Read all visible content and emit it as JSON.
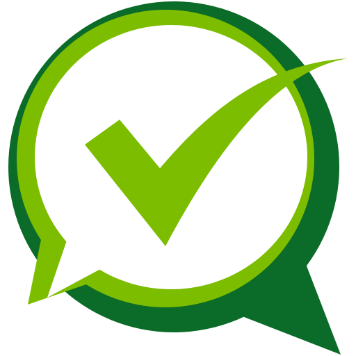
{
  "icon": {
    "name": "chat-bubble-checkmark-icon",
    "colors": {
      "outer_ring": "#0b6b28",
      "inner_ring": "#7dbd00",
      "bubble_fill": "#ffffff",
      "checkmark": "#7dbd00"
    }
  }
}
